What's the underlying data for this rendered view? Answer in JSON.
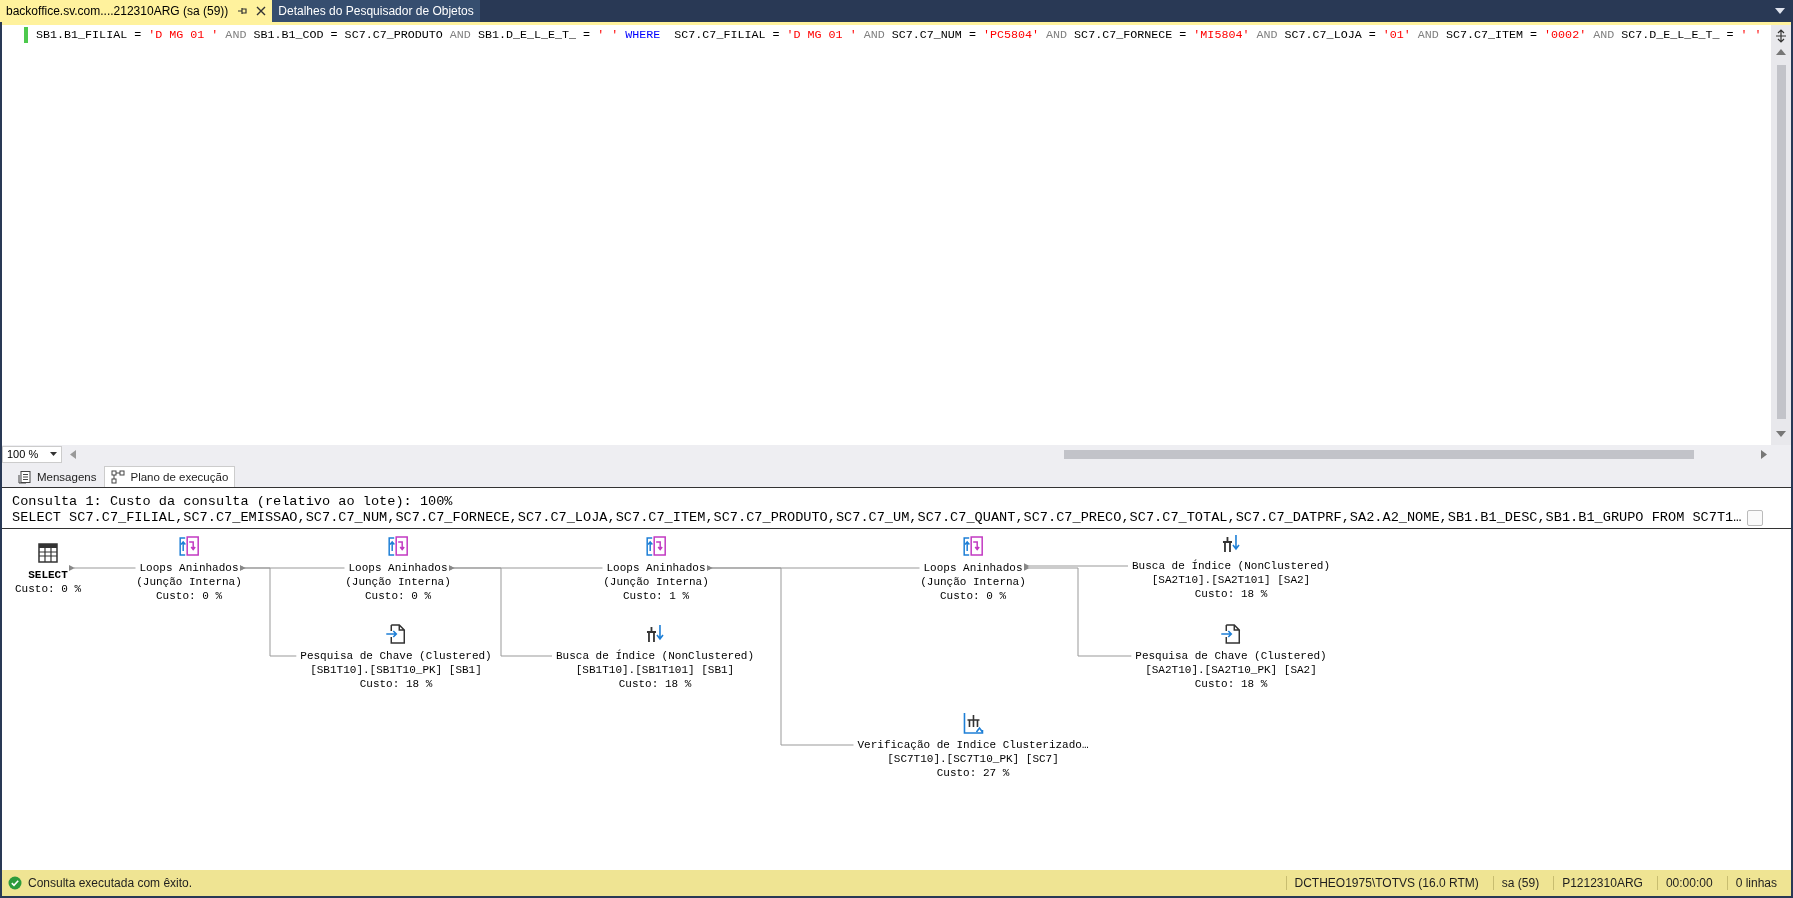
{
  "tabs": [
    {
      "label": "backoffice.sv.com....212310ARG (sa (59))",
      "selected": true,
      "pinned": true
    },
    {
      "label": "Detalhes do Pesquisador de Objetos",
      "selected": false,
      "pinned": false
    }
  ],
  "editor": {
    "lines": [
      [
        {
          "kind": "text",
          "text": "SB1.B1_FILIAL = "
        },
        {
          "kind": "string",
          "text": "'D MG 01 '"
        },
        {
          "kind": "operator",
          "text": " AND "
        },
        {
          "kind": "text",
          "text": "SB1.B1_COD = SC7.C7_PRODUTO"
        },
        {
          "kind": "operator",
          "text": " AND "
        },
        {
          "kind": "text",
          "text": "SB1.D_E_L_E_T_ = "
        },
        {
          "kind": "string",
          "text": "' '"
        },
        {
          "kind": "keyword",
          "text": " WHERE "
        },
        {
          "kind": "text",
          "text": " SC7.C7_FILIAL = "
        },
        {
          "kind": "string",
          "text": "'D MG 01 '"
        },
        {
          "kind": "operator",
          "text": " AND "
        },
        {
          "kind": "text",
          "text": "SC7.C7_NUM = "
        },
        {
          "kind": "string",
          "text": "'PC5804'"
        },
        {
          "kind": "operator",
          "text": " AND "
        },
        {
          "kind": "text",
          "text": "SC7.C7_FORNECE = "
        },
        {
          "kind": "string",
          "text": "'MI5804'"
        },
        {
          "kind": "operator",
          "text": " AND "
        },
        {
          "kind": "text",
          "text": "SC7.C7_LOJA = "
        },
        {
          "kind": "string",
          "text": "'01'"
        },
        {
          "kind": "operator",
          "text": " AND "
        },
        {
          "kind": "text",
          "text": "SC7.C7_ITEM = "
        },
        {
          "kind": "string",
          "text": "'0002'"
        },
        {
          "kind": "operator",
          "text": " AND "
        },
        {
          "kind": "text",
          "text": "SC7.D_E_L_E_T_ = "
        },
        {
          "kind": "string",
          "text": "' '"
        }
      ]
    ],
    "zoom": "100 %"
  },
  "results": {
    "tabs": [
      {
        "label": "Mensagens",
        "kind": "messages",
        "selected": false
      },
      {
        "label": "Plano de execução",
        "kind": "plan",
        "selected": true
      }
    ],
    "plan": {
      "header": "Consulta 1: Custo da consulta (relativo ao lote): 100%",
      "statement": "SELECT SC7.C7_FILIAL,SC7.C7_EMISSAO,SC7.C7_NUM,SC7.C7_FORNECE,SC7.C7_LOJA,SC7.C7_ITEM,SC7.C7_PRODUTO,SC7.C7_UM,SC7.C7_QUANT,SC7.C7_PRECO,SC7.C7_TOTAL,SC7.C7_DATPRF,SA2.A2_NOME,SB1.B1_DESC,SB1.B1_GRUPO FROM SC7T1…",
      "nodes": [
        {
          "kind": "select",
          "lines": [
            "SELECT",
            "Custo: 0 %"
          ]
        },
        {
          "kind": "nested_loops",
          "lines": [
            "Loops Aninhados",
            "(Junção Interna)",
            "Custo: 0 %"
          ]
        },
        {
          "kind": "nested_loops",
          "lines": [
            "Loops Aninhados",
            "(Junção Interna)",
            "Custo: 0 %"
          ]
        },
        {
          "kind": "nested_loops",
          "lines": [
            "Loops Aninhados",
            "(Junção Interna)",
            "Custo: 1 %"
          ]
        },
        {
          "kind": "nested_loops",
          "lines": [
            "Loops Aninhados",
            "(Junção Interna)",
            "Custo: 0 %"
          ]
        },
        {
          "kind": "index_seek",
          "lines": [
            "Busca de Índice (NonClustered)",
            "[SA2T10].[SA2T101] [SA2]",
            "Custo: 18 %"
          ]
        },
        {
          "kind": "key_lookup",
          "lines": [
            "Pesquisa de Chave (Clustered)",
            "[SB1T10].[SB1T10_PK] [SB1]",
            "Custo: 18 %"
          ]
        },
        {
          "kind": "index_seek",
          "lines": [
            "Busca de Índice (NonClustered)",
            "[SB1T10].[SB1T101] [SB1]",
            "Custo: 18 %"
          ]
        },
        {
          "kind": "key_lookup",
          "lines": [
            "Pesquisa de Chave (Clustered)",
            "[SA2T10].[SA2T10_PK] [SA2]",
            "Custo: 18 %"
          ]
        },
        {
          "kind": "clustered_scan",
          "lines": [
            "Verificação de Indice Clusterizado…",
            "[SC7T10].[SC7T10_PK] [SC7]",
            "Custo: 27 %"
          ]
        }
      ]
    }
  },
  "status_bar": {
    "success": true,
    "message": "Consulta executada com êxito.",
    "cells": [
      "DCTHEO1975\\TOTVS (16.0 RTM)",
      "sa (59)",
      "P1212310ARG",
      "00:00:00",
      "0 linhas"
    ]
  }
}
